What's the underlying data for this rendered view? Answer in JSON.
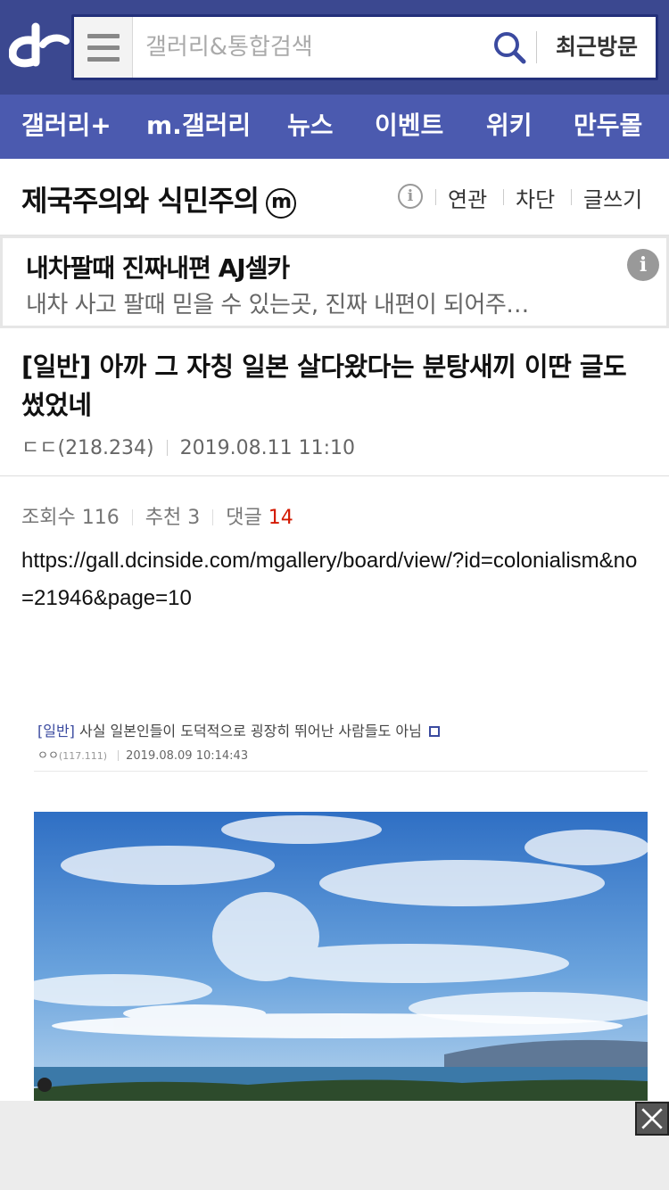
{
  "header": {
    "search_placeholder": "갤러리&통합검색",
    "recent_label": "최근방문",
    "brand_color": "#3b4890",
    "icons": [
      "dc-logo-icon",
      "hamburger-icon",
      "search-icon"
    ]
  },
  "nav": {
    "items": [
      {
        "label": "갤러리+"
      },
      {
        "label": "m.갤러리"
      },
      {
        "label": "뉴스"
      },
      {
        "label": "이벤트"
      },
      {
        "label": "위키"
      },
      {
        "label": "만두몰"
      }
    ],
    "bg_color": "#4b5aaf"
  },
  "gallery": {
    "title": "제국주의와 식민주의",
    "badge": "m",
    "actions": {
      "related": "연관",
      "block": "차단",
      "write": "글쓰기"
    }
  },
  "ad": {
    "title": "내차팔때 진짜내편 AJ셀카",
    "desc": "내차 사고 팔때 믿을 수 있는곳, 진짜 내편이 되어주…",
    "info": "i"
  },
  "post": {
    "title": "[일반] 아까 그 자칭 일본 살다왔다는 분탕새끼 이딴 글도 썼었네",
    "author": "ㄷㄷ(218.234)",
    "date": "2019.08.11 11:10",
    "views_label": "조회수",
    "views": "116",
    "recommend_label": "추천",
    "recommend": "3",
    "comments_label": "댓글",
    "comments": "14",
    "url": "https://gall.dcinside.com/mgallery/board/view/?id=colonialism&no=21946&page=10"
  },
  "embed": {
    "tag": "[일반]",
    "title": "사실 일본인들이 도덕적으로 굉장히 뛰어난 사람들도 아님",
    "author": "ㅇㅇ",
    "ip": "(117.111)",
    "date": "2019.08.09 10:14:43"
  },
  "bottom_ad": {
    "close": "close-icon"
  }
}
